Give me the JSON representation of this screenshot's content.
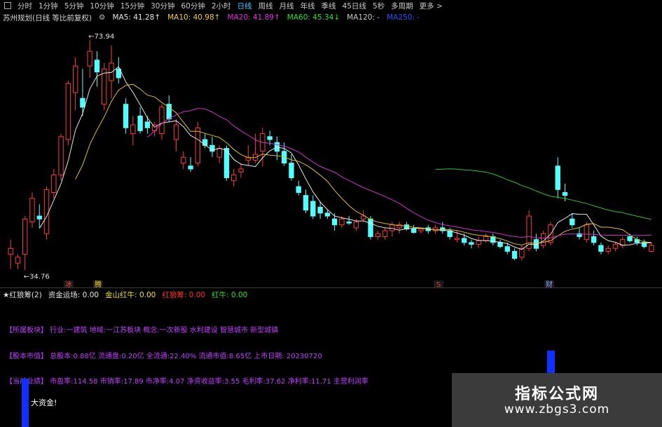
{
  "toolbar": {
    "periods": [
      "分时",
      "1分钟",
      "5分钟",
      "10分钟",
      "15分钟",
      "30分钟",
      "60分钟",
      "2小时",
      "日线",
      "周线",
      "月线",
      "年线",
      "季线",
      "45日线",
      "5秒",
      "多周期",
      "更多 >"
    ],
    "active": "日线"
  },
  "stock": {
    "name": "苏州规划(日线 等比前复权)",
    "ma": [
      {
        "label": "MA5: 41.28↑",
        "color": "#e8e8e8"
      },
      {
        "label": "MA10: 40.98↑",
        "color": "#f0d030"
      },
      {
        "label": "MA20: 41.89↑",
        "color": "#e030e0"
      },
      {
        "label": "MA60: 45.34↓",
        "color": "#30e030"
      },
      {
        "label": "MA120: -",
        "color": "#c8c8c8"
      },
      {
        "label": "MA250: -",
        "color": "#3050ff"
      }
    ]
  },
  "chart_data": {
    "type": "candlestick",
    "high_label": "73.94",
    "low_label": "34.76",
    "event_markers": [
      {
        "text": "冰",
        "color": "#ff4040"
      },
      {
        "text": "腾",
        "color": "#ffd030"
      },
      {
        "text": "S",
        "color": "#ff3030"
      },
      {
        "text": "财",
        "color": "#8aa0ff"
      }
    ],
    "candles": [
      {
        "o": 37.5,
        "h": 40.0,
        "l": 35.0,
        "c": 38.5
      },
      {
        "o": 36.0,
        "h": 37.5,
        "l": 35.0,
        "c": 37.0
      },
      {
        "o": 37.5,
        "h": 44.0,
        "l": 34.8,
        "c": 43.5
      },
      {
        "o": 43.0,
        "h": 48.0,
        "l": 42.0,
        "c": 47.0
      },
      {
        "o": 44.0,
        "h": 46.0,
        "l": 42.0,
        "c": 43.5
      },
      {
        "o": 41.0,
        "h": 49.0,
        "l": 40.0,
        "c": 48.5
      },
      {
        "o": 48.0,
        "h": 52.0,
        "l": 47.0,
        "c": 51.0
      },
      {
        "o": 51.0,
        "h": 58.0,
        "l": 50.0,
        "c": 57.5
      },
      {
        "o": 57.0,
        "h": 67.0,
        "l": 56.0,
        "c": 66.5
      },
      {
        "o": 65.0,
        "h": 71.0,
        "l": 62.0,
        "c": 69.5
      },
      {
        "o": 64.0,
        "h": 69.0,
        "l": 61.0,
        "c": 62.5
      },
      {
        "o": 69.5,
        "h": 73.94,
        "l": 67.5,
        "c": 72.0
      },
      {
        "o": 70.5,
        "h": 72.0,
        "l": 66.0,
        "c": 68.5
      },
      {
        "o": 63.0,
        "h": 70.0,
        "l": 62.0,
        "c": 69.0
      },
      {
        "o": 67.0,
        "h": 73.0,
        "l": 64.0,
        "c": 70.0
      },
      {
        "o": 69.0,
        "h": 71.0,
        "l": 66.5,
        "c": 67.5
      },
      {
        "o": 63.0,
        "h": 64.0,
        "l": 58.0,
        "c": 59.0
      },
      {
        "o": 58.0,
        "h": 61.0,
        "l": 56.0,
        "c": 59.5
      },
      {
        "o": 61.0,
        "h": 62.5,
        "l": 58.0,
        "c": 58.5
      },
      {
        "o": 60.0,
        "h": 61.0,
        "l": 58.0,
        "c": 59.0
      },
      {
        "o": 58.5,
        "h": 60.0,
        "l": 57.5,
        "c": 59.5
      },
      {
        "o": 58.0,
        "h": 63.0,
        "l": 57.0,
        "c": 62.5
      },
      {
        "o": 63.0,
        "h": 64.5,
        "l": 60.0,
        "c": 60.5
      },
      {
        "o": 57.0,
        "h": 60.5,
        "l": 55.0,
        "c": 59.5
      },
      {
        "o": 53.0,
        "h": 55.0,
        "l": 52.0,
        "c": 54.0
      },
      {
        "o": 52.5,
        "h": 54.0,
        "l": 51.5,
        "c": 52.0
      },
      {
        "o": 53.0,
        "h": 60.0,
        "l": 52.5,
        "c": 59.0
      },
      {
        "o": 57.0,
        "h": 58.0,
        "l": 55.5,
        "c": 56.0
      },
      {
        "o": 56.0,
        "h": 57.5,
        "l": 54.0,
        "c": 55.0
      },
      {
        "o": 54.0,
        "h": 56.0,
        "l": 53.0,
        "c": 55.5
      },
      {
        "o": 55.5,
        "h": 56.0,
        "l": 50.0,
        "c": 50.5
      },
      {
        "o": 50.0,
        "h": 52.0,
        "l": 49.0,
        "c": 51.0
      },
      {
        "o": 51.5,
        "h": 53.0,
        "l": 50.5,
        "c": 52.0
      },
      {
        "o": 53.5,
        "h": 56.0,
        "l": 52.5,
        "c": 54.0
      },
      {
        "o": 53.5,
        "h": 58.0,
        "l": 53.0,
        "c": 54.5
      },
      {
        "o": 55.0,
        "h": 59.0,
        "l": 52.5,
        "c": 58.0
      },
      {
        "o": 57.5,
        "h": 58.5,
        "l": 56.0,
        "c": 57.0
      },
      {
        "o": 56.5,
        "h": 57.5,
        "l": 53.5,
        "c": 55.0
      },
      {
        "o": 55.0,
        "h": 56.5,
        "l": 52.5,
        "c": 53.0
      },
      {
        "o": 53.0,
        "h": 54.5,
        "l": 50.0,
        "c": 50.5
      },
      {
        "o": 49.0,
        "h": 50.0,
        "l": 47.5,
        "c": 48.0
      },
      {
        "o": 47.5,
        "h": 48.5,
        "l": 44.5,
        "c": 45.0
      },
      {
        "o": 46.5,
        "h": 47.5,
        "l": 43.5,
        "c": 44.0
      },
      {
        "o": 45.5,
        "h": 46.5,
        "l": 43.5,
        "c": 44.5
      },
      {
        "o": 44.5,
        "h": 45.0,
        "l": 43.5,
        "c": 44.0
      },
      {
        "o": 43.5,
        "h": 44.5,
        "l": 41.5,
        "c": 42.5
      },
      {
        "o": 42.5,
        "h": 44.0,
        "l": 42.0,
        "c": 43.5
      },
      {
        "o": 43.0,
        "h": 44.0,
        "l": 42.5,
        "c": 42.8
      },
      {
        "o": 42.0,
        "h": 43.5,
        "l": 41.5,
        "c": 43.0
      },
      {
        "o": 43.5,
        "h": 45.0,
        "l": 43.0,
        "c": 44.0
      },
      {
        "o": 43.5,
        "h": 44.0,
        "l": 40.0,
        "c": 40.5
      },
      {
        "o": 40.5,
        "h": 41.5,
        "l": 40.0,
        "c": 41.0
      },
      {
        "o": 40.5,
        "h": 42.0,
        "l": 40.0,
        "c": 41.5
      },
      {
        "o": 41.5,
        "h": 43.0,
        "l": 40.5,
        "c": 42.5
      },
      {
        "o": 42.0,
        "h": 43.0,
        "l": 41.0,
        "c": 42.5
      },
      {
        "o": 42.5,
        "h": 43.0,
        "l": 41.5,
        "c": 41.8
      },
      {
        "o": 41.8,
        "h": 42.5,
        "l": 41.0,
        "c": 41.2
      },
      {
        "o": 41.5,
        "h": 42.0,
        "l": 41.0,
        "c": 41.8
      },
      {
        "o": 42.0,
        "h": 42.5,
        "l": 41.0,
        "c": 41.5
      },
      {
        "o": 41.5,
        "h": 42.5,
        "l": 41.0,
        "c": 42.0
      },
      {
        "o": 42.0,
        "h": 43.0,
        "l": 41.0,
        "c": 41.5
      },
      {
        "o": 41.5,
        "h": 42.0,
        "l": 40.0,
        "c": 40.5
      },
      {
        "o": 40.0,
        "h": 41.5,
        "l": 39.5,
        "c": 40.2
      },
      {
        "o": 40.2,
        "h": 41.0,
        "l": 39.0,
        "c": 39.5
      },
      {
        "o": 39.5,
        "h": 40.0,
        "l": 38.5,
        "c": 39.2
      },
      {
        "o": 39.2,
        "h": 40.5,
        "l": 38.5,
        "c": 39.8
      },
      {
        "o": 39.8,
        "h": 41.0,
        "l": 39.5,
        "c": 40.5
      },
      {
        "o": 40.5,
        "h": 41.0,
        "l": 39.0,
        "c": 39.5
      },
      {
        "o": 39.5,
        "h": 40.0,
        "l": 38.5,
        "c": 38.8
      },
      {
        "o": 38.8,
        "h": 39.5,
        "l": 37.5,
        "c": 38.0
      },
      {
        "o": 38.0,
        "h": 38.5,
        "l": 36.5,
        "c": 36.8
      },
      {
        "o": 37.0,
        "h": 39.0,
        "l": 36.5,
        "c": 38.5
      },
      {
        "o": 38.5,
        "h": 45.0,
        "l": 38.0,
        "c": 44.0
      },
      {
        "o": 40.0,
        "h": 41.0,
        "l": 38.0,
        "c": 38.5
      },
      {
        "o": 39.0,
        "h": 41.5,
        "l": 38.5,
        "c": 41.0
      },
      {
        "o": 39.5,
        "h": 43.0,
        "l": 39.0,
        "c": 42.5
      },
      {
        "o": 52.5,
        "h": 54.0,
        "l": 47.0,
        "c": 48.5
      },
      {
        "o": 48.0,
        "h": 49.5,
        "l": 46.5,
        "c": 47.5
      },
      {
        "o": 43.5,
        "h": 44.5,
        "l": 42.0,
        "c": 42.5
      },
      {
        "o": 41.0,
        "h": 42.0,
        "l": 40.0,
        "c": 40.5
      },
      {
        "o": 40.0,
        "h": 43.0,
        "l": 39.5,
        "c": 42.5
      },
      {
        "o": 40.5,
        "h": 41.5,
        "l": 39.0,
        "c": 39.5
      },
      {
        "o": 39.0,
        "h": 39.5,
        "l": 37.5,
        "c": 38.0
      },
      {
        "o": 38.0,
        "h": 39.0,
        "l": 37.5,
        "c": 38.5
      },
      {
        "o": 38.5,
        "h": 39.5,
        "l": 38.0,
        "c": 39.2
      },
      {
        "o": 39.0,
        "h": 40.5,
        "l": 38.5,
        "c": 40.0
      },
      {
        "o": 40.5,
        "h": 41.0,
        "l": 39.5,
        "c": 39.8
      },
      {
        "o": 40.0,
        "h": 40.5,
        "l": 39.0,
        "c": 39.5
      },
      {
        "o": 39.5,
        "h": 40.0,
        "l": 38.5,
        "c": 38.8
      },
      {
        "o": 38.0,
        "h": 39.5,
        "l": 37.8,
        "c": 39.0
      }
    ],
    "ma_lines": [
      {
        "name": "MA5",
        "color": "#e8e8e8"
      },
      {
        "name": "MA10",
        "color": "#e0c020"
      },
      {
        "name": "MA20",
        "color": "#d030d0"
      },
      {
        "name": "MA60",
        "color": "#30c030"
      }
    ]
  },
  "indicator": {
    "name": "★红狼筹(2)",
    "items": [
      {
        "label": "资金运场: 0.00",
        "color": "#e8e8e8"
      },
      {
        "label": "金山红牛: 0.00",
        "color": "#f0e030"
      },
      {
        "label": "红狼筹: 0.00",
        "color": "#ff3030"
      },
      {
        "label": "红牛: 0.00",
        "color": "#30e030"
      }
    ]
  },
  "info": {
    "sector": "【所属板块】 行业:一建筑 地域:一江苏板块 概念:一次新股 水利建设 智慧城市 新型城镇",
    "capital": "【股本市值】 总股本:0.88亿 流通盘:0.20亿 全流通:22.40% 流通市值:8.65亿 上市日期: 20230720",
    "perf": "【当前业绩】 市盈率:114.58 市销率:17.89 市净率:4.07 净资收益率:3.55 毛利率:37.62 净利率:11.71 主营利润率",
    "fund_alert": "大资金!"
  },
  "watermark": {
    "title": "指标公式网",
    "url": "www.zbgs3.com"
  }
}
